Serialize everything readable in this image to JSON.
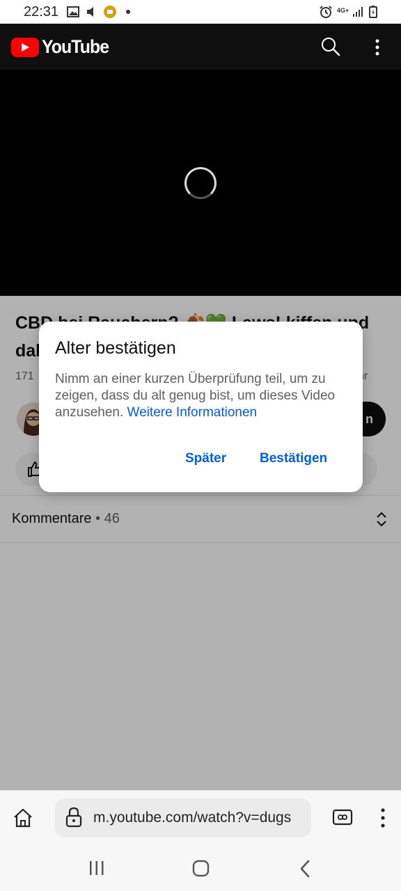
{
  "status_bar": {
    "time": "22:31",
    "left_icons": [
      "gallery-icon",
      "volume-icon",
      "app-notification-icon",
      "dot-icon"
    ],
    "right_icons": [
      "alarm-icon",
      "network-4g-icon",
      "signal-icon",
      "battery-icon"
    ],
    "network_label": "4G+"
  },
  "header": {
    "logo_text": "YouTube",
    "icons": [
      "search-icon",
      "more-vert-icon"
    ]
  },
  "video": {
    "title_line1": "CBD bei Rauchern? 🍂💚 Laws! kiffen und",
    "title_line2": "dab",
    "meta_left": "171",
    "meta_right": "hr",
    "subscribe_label": "n"
  },
  "comments": {
    "label": "Kommentare",
    "separator": "•",
    "count": "46"
  },
  "dialog": {
    "title": "Alter bestätigen",
    "body": "Nimm an einer kurzen Überprüfung teil, um zu zeigen, dass du alt genug bist, um dieses Video anzusehen.",
    "link": "Weitere Informationen",
    "later_button": "Später",
    "confirm_button": "Bestätigen"
  },
  "browser": {
    "url": "m.youtube.com/watch?v=dugs",
    "icons": [
      "home-icon",
      "lock-icon",
      "tabs-icon",
      "menu-icon"
    ]
  },
  "colors": {
    "youtube_red": "#ff0000",
    "header_bg": "#0f0f0f",
    "link_blue": "#065fd4"
  }
}
